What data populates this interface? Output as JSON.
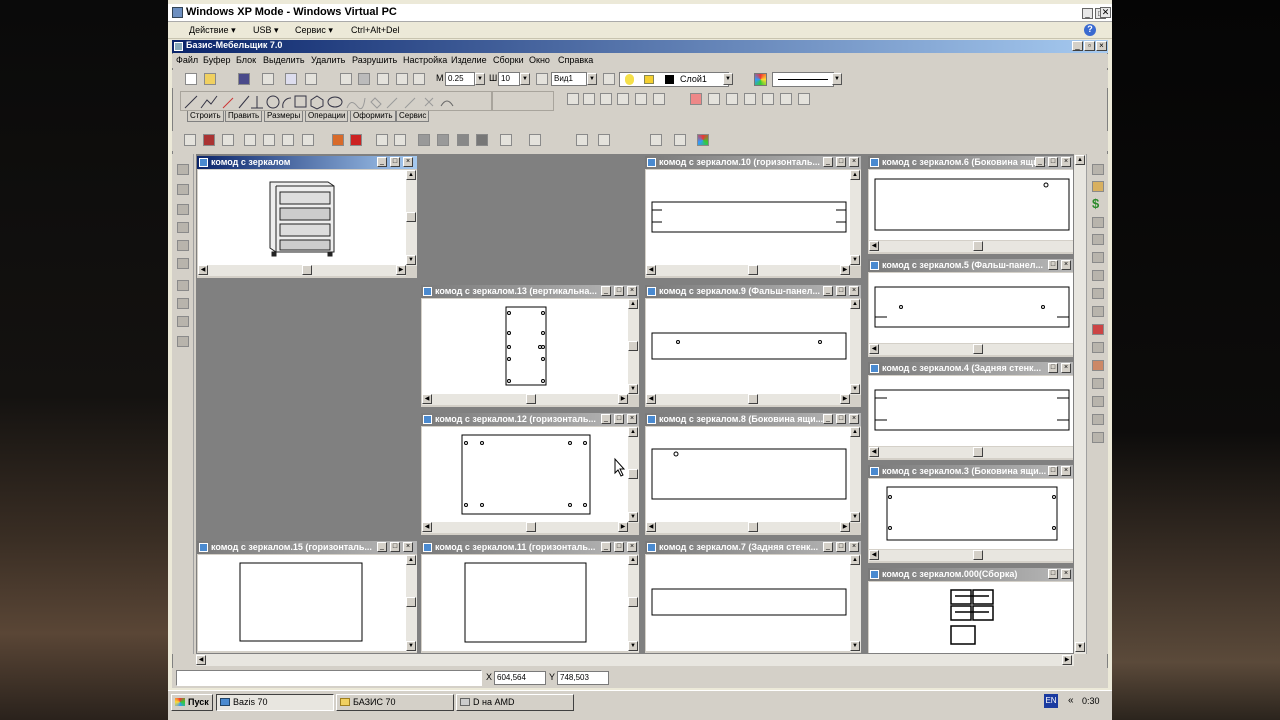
{
  "host": {
    "title": "Windows XP Mode - Windows Virtual PC",
    "menu": [
      "Действие ▾",
      "USB ▾",
      "Сервис ▾",
      "Ctrl+Alt+Del"
    ],
    "help": "?"
  },
  "app": {
    "title": "Базис-Мебельщик 7.0",
    "menu": [
      "Файл",
      "Буфер",
      "Блок",
      "Выделить",
      "Удалить",
      "Разрушить",
      "Настройка",
      "Изделие",
      "Сборки",
      "Окно",
      "Справка"
    ],
    "toolbar": {
      "thickness": "0.25",
      "step_label": "Ш",
      "step": "10",
      "view": "Вид1",
      "layer": "Слой1",
      "m_label": "М"
    },
    "tabs": [
      "Строить",
      "Править",
      "Размеры",
      "Операции",
      "Оформить",
      "Сервис"
    ]
  },
  "windows": {
    "w0": "комод с зеркалом",
    "w10": "комод с зеркалом.10 (горизонталь...",
    "w6": "комод с зеркалом.6 (Боковина ящи...",
    "w5": "комод с зеркалом.5 (Фальш-панел...",
    "w13": "комод с зеркалом.13 (вертикальна...",
    "w9": "комод с зеркалом.9 (Фальш-панел...",
    "w4": "комод с зеркалом.4 (Задняя стенк...",
    "w12": "комод с зеркалом.12 (горизонталь...",
    "w8": "комод с зеркалом.8 (Боковина ящи...",
    "w3": "комод с зеркалом.3 (Боковина ящи...",
    "w15": "комод с зеркалом.15 (горизонталь...",
    "w11": "комод с зеркалом.11 (горизонталь...",
    "w7": "комод с зеркалом.7 (Задняя стенк...",
    "w000": "комод с зеркалом.000(Сборка)"
  },
  "status": {
    "x": "604,564",
    "y": "748,503",
    "x_label": "X",
    "y_label": "Y"
  },
  "taskbar": {
    "start": "Пуск",
    "items": [
      "Bazis 70",
      "БАЗИС 70",
      "D на AMD"
    ],
    "lang": "EN",
    "chev": "«",
    "time": "0:30"
  }
}
